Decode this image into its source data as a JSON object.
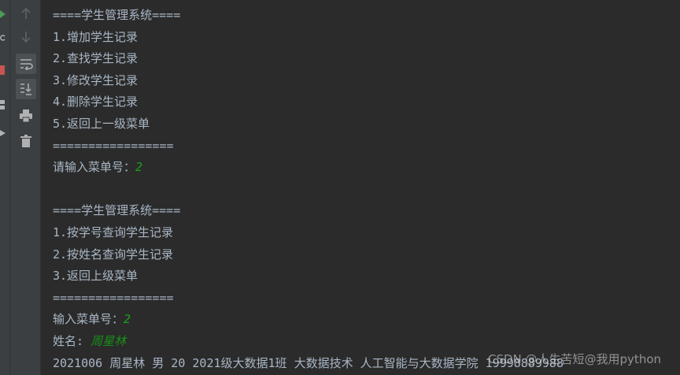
{
  "console": {
    "lines": [
      {
        "text": "====学生管理系统===="
      },
      {
        "text": "1.增加学生记录"
      },
      {
        "text": "2.查找学生记录"
      },
      {
        "text": "3.修改学生记录"
      },
      {
        "text": "4.删除学生记录"
      },
      {
        "text": "5.返回上一级菜单"
      },
      {
        "text": "================="
      },
      {
        "text": "请输入菜单号：",
        "input": "2"
      },
      {
        "text": ""
      },
      {
        "text": "====学生管理系统===="
      },
      {
        "text": "1.按学号查询学生记录"
      },
      {
        "text": "2.按姓名查询学生记录"
      },
      {
        "text": "3.返回上级菜单"
      },
      {
        "text": "================="
      },
      {
        "text": "输入菜单号：",
        "input": "2"
      },
      {
        "text": "姓名: ",
        "input": "周星林"
      },
      {
        "text": "2021006 周星林 男 20 2021级大数据1班 大数据技术 人工智能与大数据学院 19998889988"
      }
    ]
  },
  "watermark": "CSDN @人生苦短@我用python",
  "toolbar": {
    "icons": [
      "arrow-up-icon",
      "arrow-down-icon",
      "soft-wrap-icon",
      "scroll-to-end-icon",
      "print-icon",
      "trash-icon"
    ]
  },
  "colors": {
    "background": "#2b2b2b",
    "text": "#a9b7c6",
    "user_input": "#18a018"
  }
}
